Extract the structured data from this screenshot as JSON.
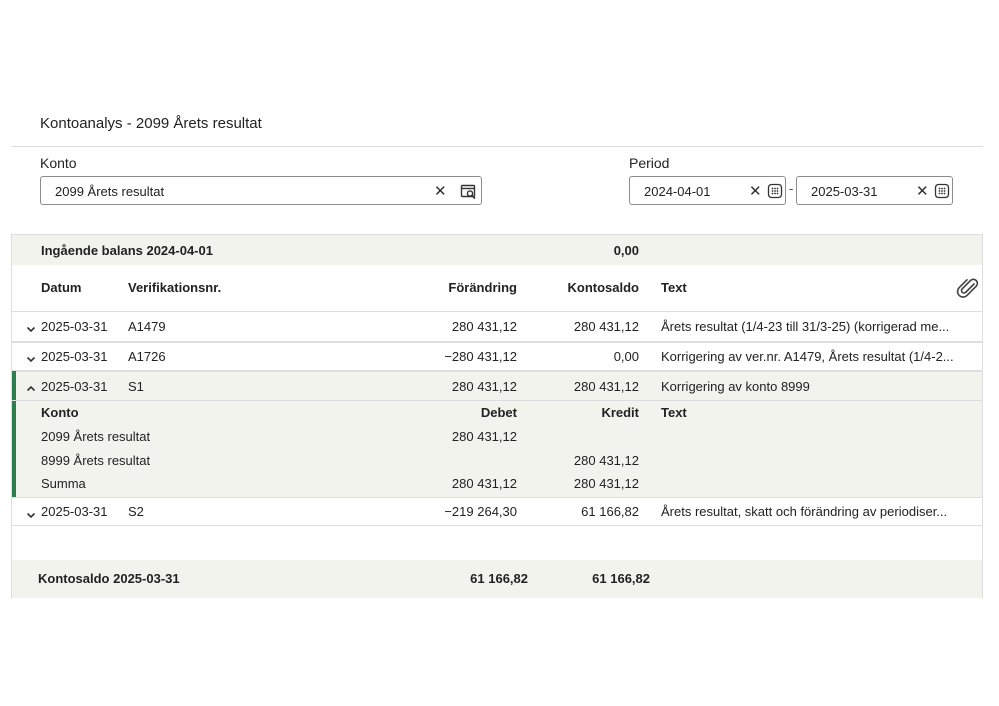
{
  "page": {
    "title": "Kontoanalys - 2099 Årets resultat"
  },
  "konto": {
    "label": "Konto",
    "value": "2099 Årets resultat"
  },
  "period": {
    "label": "Period",
    "from": "2024-04-01",
    "to": "2025-03-31",
    "separator": "-"
  },
  "opening": {
    "label": "Ingående balans 2024-04-01",
    "value": "0,00"
  },
  "columns": {
    "date": "Datum",
    "ver": "Verifikationsnr.",
    "change": "Förändring",
    "balance": "Kontosaldo",
    "text": "Text"
  },
  "rows": [
    {
      "date": "2025-03-31",
      "ver": "A1479",
      "change": "280 431,12",
      "balance": "280 431,12",
      "text": "Årets resultat (1/4-23 till 31/3-25) (korrigerad me...",
      "expanded": false
    },
    {
      "date": "2025-03-31",
      "ver": "A1726",
      "change": "−280 431,12",
      "balance": "0,00",
      "text": "Korrigering av ver.nr. A1479, Årets resultat (1/4-2...",
      "expanded": false
    },
    {
      "date": "2025-03-31",
      "ver": "S1",
      "change": "280 431,12",
      "balance": "280 431,12",
      "text": "Korrigering av konto 8999",
      "expanded": true
    },
    {
      "date": "2025-03-31",
      "ver": "S2",
      "change": "−219 264,30",
      "balance": "61 166,82",
      "text": "Årets resultat, skatt och förändring av periodiser...",
      "expanded": false
    }
  ],
  "detail": {
    "columns": {
      "account": "Konto",
      "debit": "Debet",
      "credit": "Kredit",
      "text": "Text"
    },
    "lines": [
      {
        "account": "2099 Årets resultat",
        "debit": "280 431,12",
        "credit": ""
      },
      {
        "account": "8999 Årets resultat",
        "debit": "",
        "credit": "280 431,12"
      },
      {
        "account": "Summa",
        "debit": "280 431,12",
        "credit": "280 431,12"
      }
    ]
  },
  "closing": {
    "label": "Kontosaldo 2025-03-31",
    "change": "61 166,82",
    "balance": "61 166,82"
  },
  "icons": {
    "clear": "close-icon",
    "search": "account-search-icon",
    "calendar": "calendar-icon",
    "attachment": "paperclip-icon",
    "expand": "chevron-down-icon",
    "collapse": "chevron-up-icon"
  },
  "colors": {
    "accent": "#2e7d4f",
    "band": "#f3f3ee"
  }
}
